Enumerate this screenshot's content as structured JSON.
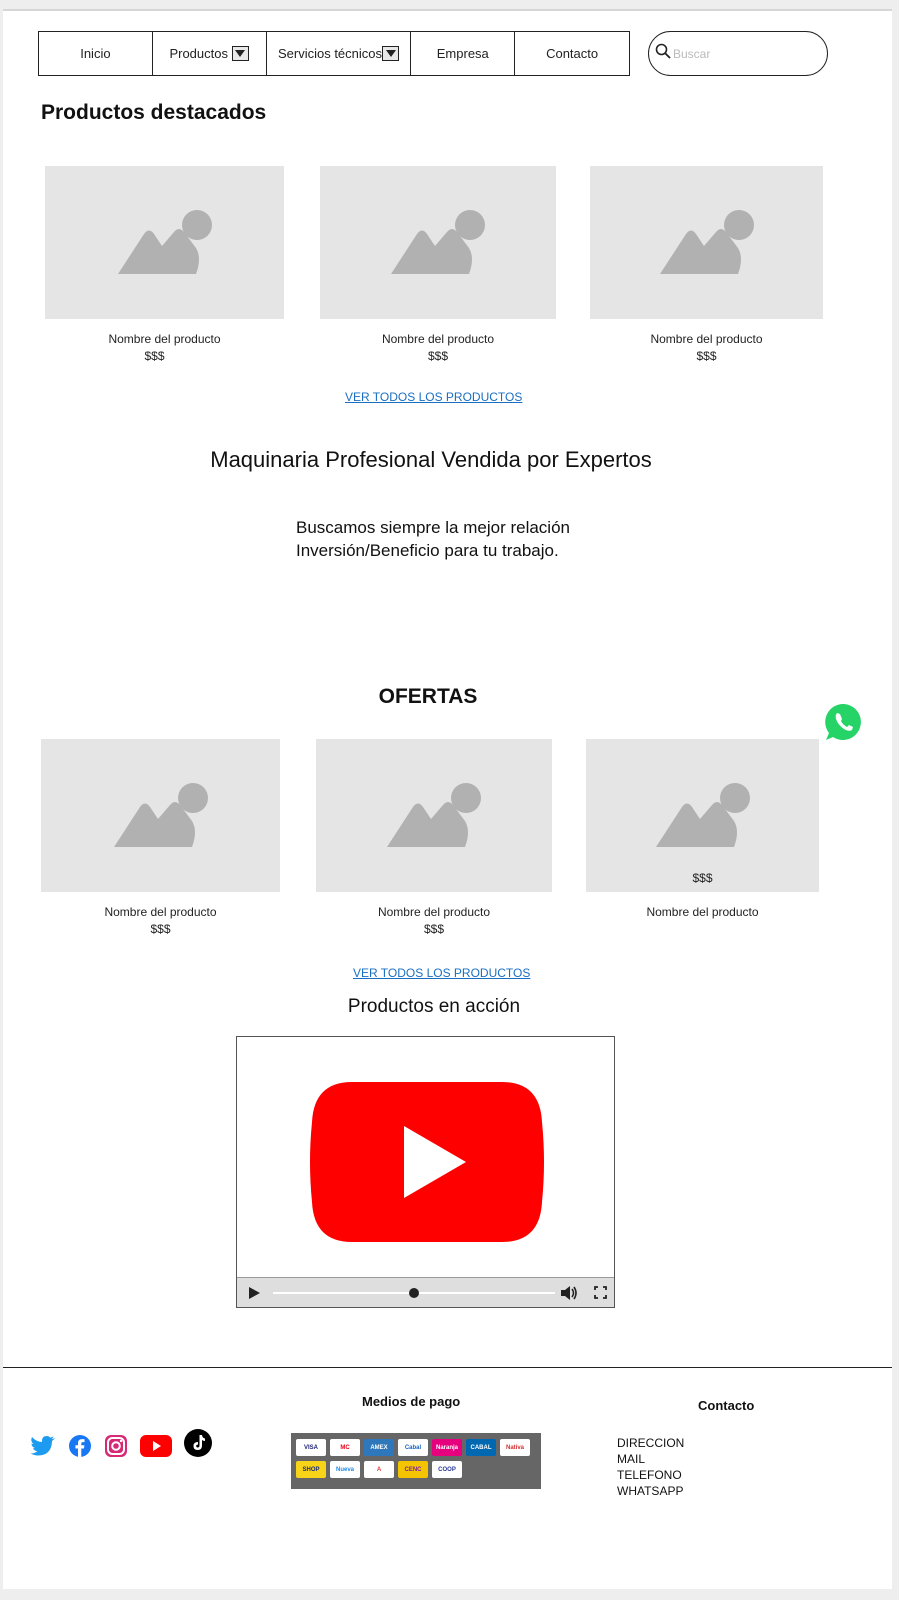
{
  "nav": {
    "items": [
      {
        "label": "Inicio",
        "dropdown": false
      },
      {
        "label": "Productos",
        "dropdown": true
      },
      {
        "label": "Servicios técnicos",
        "dropdown": true
      },
      {
        "label": "Empresa",
        "dropdown": false
      },
      {
        "label": "Contacto",
        "dropdown": false
      }
    ],
    "search_placeholder": "Buscar"
  },
  "featured": {
    "title": "Productos destacados",
    "products": [
      {
        "name": "Nombre del producto",
        "price": "$$$"
      },
      {
        "name": "Nombre del producto",
        "price": "$$$"
      },
      {
        "name": "Nombre del producto",
        "price": "$$$"
      }
    ],
    "view_all": "VER TODOS LOS PRODUCTOS"
  },
  "tagline": {
    "title": "Maquinaria Profesional Vendida por Expertos",
    "line1": "Buscamos siempre la mejor relación",
    "line2": "Inversión/Beneficio para tu trabajo."
  },
  "offers": {
    "title": "OFERTAS",
    "products": [
      {
        "name": "Nombre del producto",
        "price": "$$$"
      },
      {
        "name": "Nombre del producto",
        "price": "$$$"
      },
      {
        "name": "Nombre del producto",
        "price": "$$$"
      }
    ],
    "view_all": "VER TODOS LOS PRODUCTOS"
  },
  "video": {
    "title": "Productos en acción",
    "progress": 0.5
  },
  "footer": {
    "payments_title": "Medios de pago",
    "contact_title": "Contacto",
    "contact_items": [
      "DIRECCION",
      "MAIL",
      "TELEFONO",
      "WHATSAPP"
    ],
    "social": [
      "twitter-icon",
      "facebook-icon",
      "instagram-icon",
      "youtube-icon",
      "tiktok-icon"
    ],
    "payment_methods": [
      {
        "label": "VISA",
        "bg": "#ffffff",
        "fg": "#1a1f71"
      },
      {
        "label": "MC",
        "bg": "#ffffff",
        "fg": "#eb001b"
      },
      {
        "label": "AMEX",
        "bg": "#2e77bb",
        "fg": "#ffffff"
      },
      {
        "label": "Cabal",
        "bg": "#ffffff",
        "fg": "#1565c0"
      },
      {
        "label": "Naranja",
        "bg": "#e6007e",
        "fg": "#ffffff"
      },
      {
        "label": "CABAL",
        "bg": "#0067b1",
        "fg": "#ffffff"
      },
      {
        "label": "Nativa",
        "bg": "#ffffff",
        "fg": "#d32f2f"
      },
      {
        "label": "SHOP",
        "bg": "#f7d417",
        "fg": "#1a2a80"
      },
      {
        "label": "Nueva",
        "bg": "#ffffff",
        "fg": "#1e88e5"
      },
      {
        "label": "A",
        "bg": "#ffffff",
        "fg": "#e53935"
      },
      {
        "label": "CENC",
        "bg": "#f5c400",
        "fg": "#7b1fa2"
      },
      {
        "label": "COOP",
        "bg": "#ffffff",
        "fg": "#283593"
      }
    ]
  },
  "colors": {
    "link": "#1a6fc2",
    "youtube_red": "#ff0000",
    "whatsapp_green": "#25d366",
    "placeholder_gray": "#e5e5e5"
  }
}
